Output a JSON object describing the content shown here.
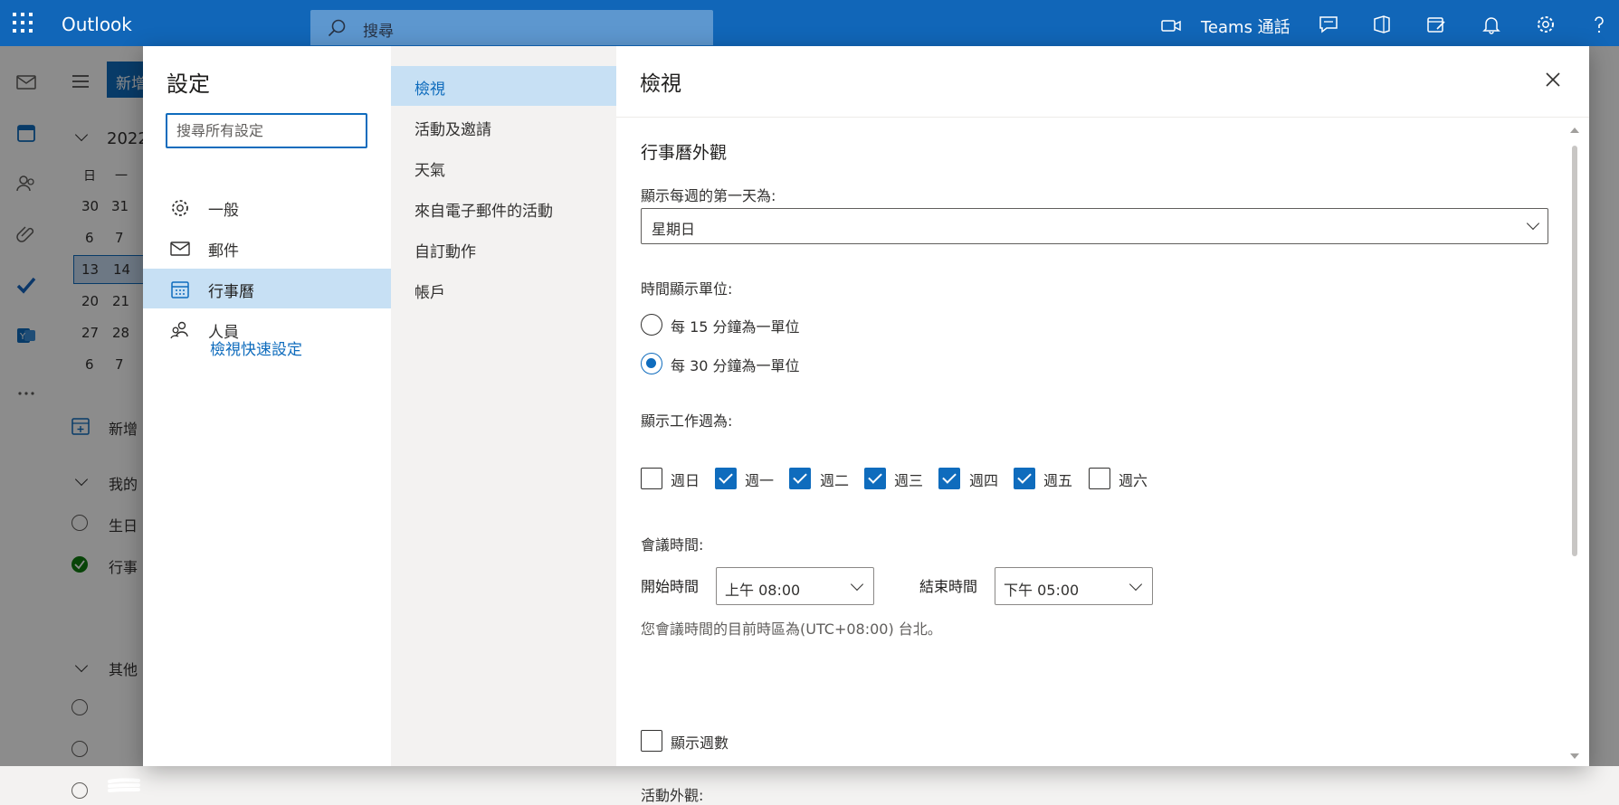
{
  "topbar": {
    "app_name": "Outlook",
    "search_placeholder": "搜尋",
    "teams_label": "Teams 通話"
  },
  "underlay": {
    "new_button": "新增",
    "month_label": "2022",
    "weekday_headers": [
      "日",
      "一"
    ],
    "calendar_rows": [
      [
        "30",
        "31"
      ],
      [
        "6",
        "7"
      ],
      [
        "13",
        "14"
      ],
      [
        "20",
        "21"
      ],
      [
        "27",
        "28"
      ],
      [
        "6",
        "7"
      ]
    ],
    "add_calendar": "新增",
    "my_calendars": "我的",
    "birthday": "生日",
    "calendar": "行事",
    "other_calendars": "其他"
  },
  "settings": {
    "title": "設定",
    "search_placeholder": "搜尋所有設定",
    "categories": [
      {
        "label": "一般",
        "icon": "gear-icon"
      },
      {
        "label": "郵件",
        "icon": "mail-icon"
      },
      {
        "label": "行事曆",
        "icon": "calendar-icon",
        "selected": true
      },
      {
        "label": "人員",
        "icon": "people-icon"
      }
    ],
    "quick_settings_link": "檢視快速設定",
    "subcategories": [
      {
        "label": "檢視",
        "selected": true
      },
      {
        "label": "活動及邀請"
      },
      {
        "label": "天氣"
      },
      {
        "label": "來自電子郵件的活動"
      },
      {
        "label": "自訂動作"
      },
      {
        "label": "帳戶"
      }
    ]
  },
  "pane": {
    "title": "檢視",
    "section_appearance": "行事曆外觀",
    "first_day_label": "顯示每週的第一天為:",
    "first_day_value": "星期日",
    "time_scale_label": "時間顯示單位:",
    "time_scale_options": [
      {
        "label": "每 15 分鐘為一單位",
        "checked": false
      },
      {
        "label": "每 30 分鐘為一單位",
        "checked": true
      }
    ],
    "work_week_label": "顯示工作週為:",
    "work_week_days": [
      {
        "label": "週日",
        "checked": false
      },
      {
        "label": "週一",
        "checked": true
      },
      {
        "label": "週二",
        "checked": true
      },
      {
        "label": "週三",
        "checked": true
      },
      {
        "label": "週四",
        "checked": true
      },
      {
        "label": "週五",
        "checked": true
      },
      {
        "label": "週六",
        "checked": false
      }
    ],
    "meeting_hours_label": "會議時間:",
    "start_time_label": "開始時間",
    "start_time_value": "上午 08:00",
    "end_time_label": "結束時間",
    "end_time_value": "下午 05:00",
    "timezone_note": "您會議時間的目前時區為(UTC+08:00) 台北。",
    "show_week_numbers_label": "顯示週數",
    "show_week_numbers_checked": false,
    "event_appearance_label": "活動外觀:"
  },
  "colors": {
    "brand": "#1166b8",
    "accent": "#0f6cbd",
    "selected_bg": "#c7e0f4"
  }
}
